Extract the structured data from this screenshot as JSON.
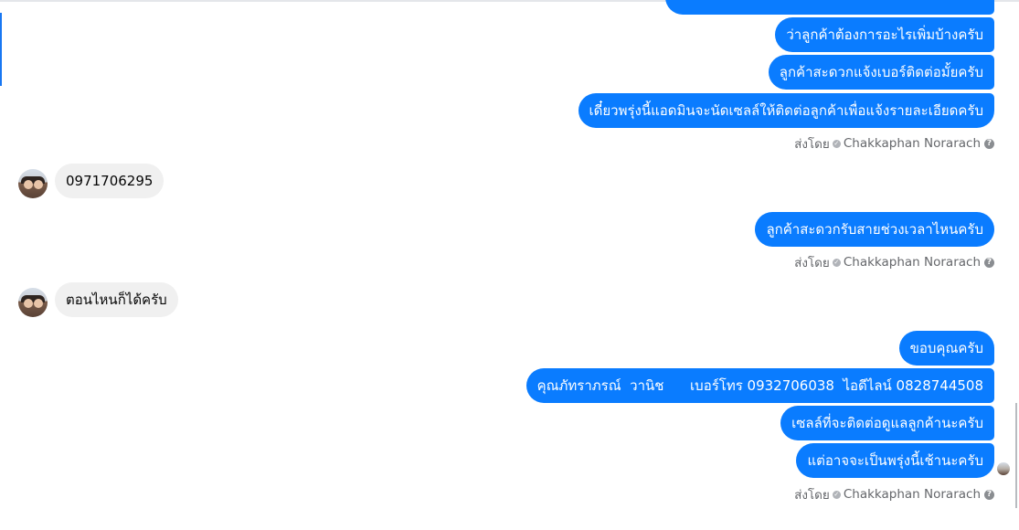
{
  "conversation": {
    "sent_by_prefix": "ส่งโดย",
    "sender_name": "Chakkaphan Norarach",
    "groups": [
      {
        "type": "outgoing",
        "messages": [
          "ว่าลูกค้าต้องการอะไรเพิ่มบ้างครับ",
          "ลูกค้าสะดวกแจ้งเบอร์ติดต่อมั้ยครับ",
          "เดี๋ยวพรุ่งนี้แอดมินจะนัดเซลล์ให้ติดต่อลูกค้าเพื่อแจ้งรายละเอียดครับ"
        ]
      },
      {
        "type": "incoming",
        "messages": [
          "0971706295"
        ]
      },
      {
        "type": "outgoing",
        "messages": [
          "ลูกค้าสะดวกรับสายช่วงเวลาไหนครับ"
        ]
      },
      {
        "type": "incoming",
        "messages": [
          "ตอนไหนก็ได้ครับ"
        ]
      },
      {
        "type": "outgoing",
        "messages": [
          "ขอบคุณครับ",
          "คุณภัทราภรณ์  วานิช      เบอร์โทร 0932706038  ไอดีไลน์ 0828744508",
          "เซลล์ที่จะติดต่อดูแลลูกค้านะครับ",
          "แต่อาจจะเป็นพรุ่งนี้เช้านะครับ"
        ]
      }
    ]
  },
  "colors": {
    "outgoing": "#0a7cff",
    "incoming": "#f0f0f0",
    "meta": "#65676b"
  },
  "icons": {
    "verified": "check-icon",
    "help": "help-icon"
  }
}
